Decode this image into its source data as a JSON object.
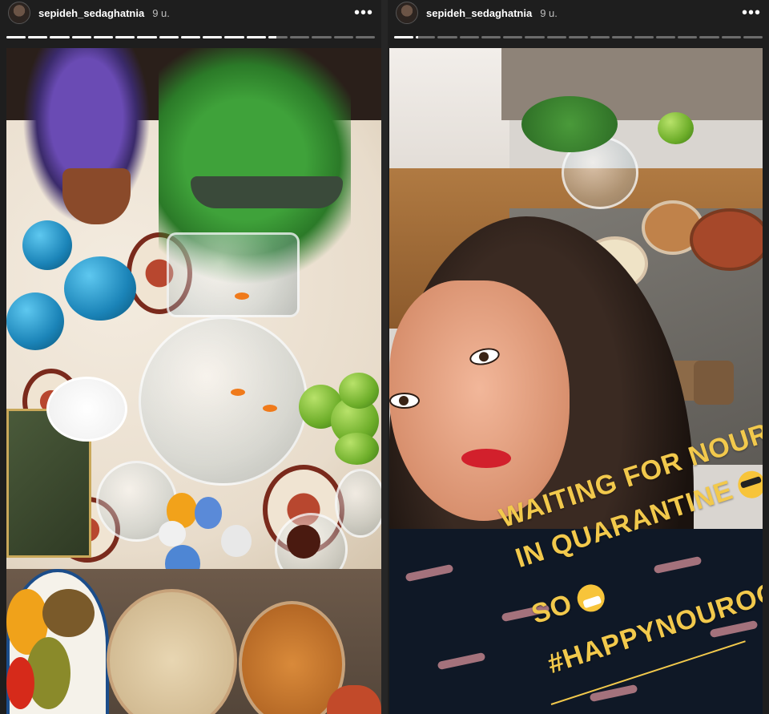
{
  "stories": [
    {
      "username": "sepideh_sedaghatnia",
      "time": "9 u.",
      "more_icon": "more-horizontal-icon",
      "progress": [
        1,
        1,
        1,
        1,
        1,
        1,
        1,
        1,
        1,
        1,
        1,
        1,
        0.4,
        0,
        0,
        0,
        0
      ],
      "photo_description_icon": "photo"
    },
    {
      "username": "sepideh_sedaghatnia",
      "time": "9 u.",
      "more_icon": "more-horizontal-icon",
      "progress": [
        1,
        0.1,
        0,
        0,
        0,
        0,
        0,
        0,
        0,
        0,
        0,
        0,
        0,
        0,
        0,
        0,
        0
      ],
      "caption": {
        "line1": "WAITING FOR NOUROOZ",
        "line2": "IN QUARANTINE",
        "line3": "SO",
        "line4": "#HAPPYNOUROOZ",
        "color": "#f2c94c",
        "emoji1": "smiling-face-with-sunglasses-icon",
        "emoji2": "face-with-medical-mask-icon"
      }
    }
  ]
}
